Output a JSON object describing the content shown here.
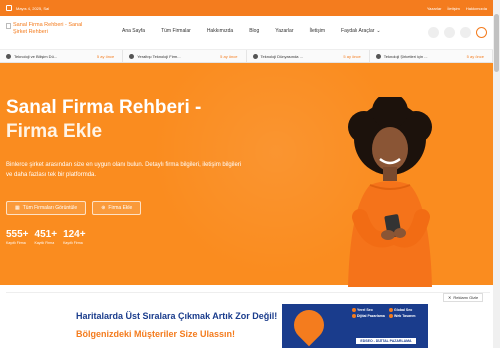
{
  "topbar": {
    "date": "Mayıs 4, 2025, Sal",
    "links": [
      "Yazarlar",
      "İletişim",
      "Hakkımızda"
    ]
  },
  "header": {
    "logo_alt": "Sanal Firma Rehberi - Sanal Şirket Rehberi",
    "nav": [
      "Ana Sayfa",
      "Tüm Firmalar",
      "Hakkımızda",
      "Blog",
      "Yazarlar",
      "İletişim",
      "Faydalı Araçlar"
    ]
  },
  "ticker": [
    {
      "title": "Teknoloji ve Bilişim Dü...",
      "time": "5 ay önce"
    },
    {
      "title": "Yeraltışı Teknoloji Firm...",
      "time": "5 ay önce"
    },
    {
      "title": "Teknoloji Dünyasında ...",
      "time": "5 ay önce"
    },
    {
      "title": "Teknoloji Şirketleri için ...",
      "time": "5 ay önce"
    }
  ],
  "hero": {
    "title_line1": "Sanal Firma Rehberi -",
    "title_line2": "Firma Ekle",
    "description": "Binlerce şirket arasından size en uygun olanı bulun. Detaylı firma bilgileri, iletişim bilgileri ve daha fazlası tek bir platformda.",
    "btn_all": "Tüm Firmaları Görüntüle",
    "btn_add": "Firma Ekle",
    "stats": [
      {
        "value": "555+",
        "label": "Kayıtlı Firma"
      },
      {
        "value": "451+",
        "label": "Kayıtlı Firma"
      },
      {
        "value": "124+",
        "label": "Kayıtlı Firma"
      }
    ]
  },
  "ads": {
    "close_label": "Reklamı Gizle",
    "banner_line1": "Haritalarda Üst Sıralara Çıkmak Artık Zor Değil!",
    "banner_line2": "Bölgenizdeki Müşteriler Size Ulassın!",
    "features": [
      "Yerel Seo",
      "Global Seo",
      "Dijital Pazarlama",
      "Web Tasarım"
    ],
    "brand": "EDSEO - DİJİTAL PAZARLAMA"
  },
  "colors": {
    "brand": "#f47c1e",
    "hero": "#fa8c1f",
    "banner": "#1a3c8c"
  }
}
